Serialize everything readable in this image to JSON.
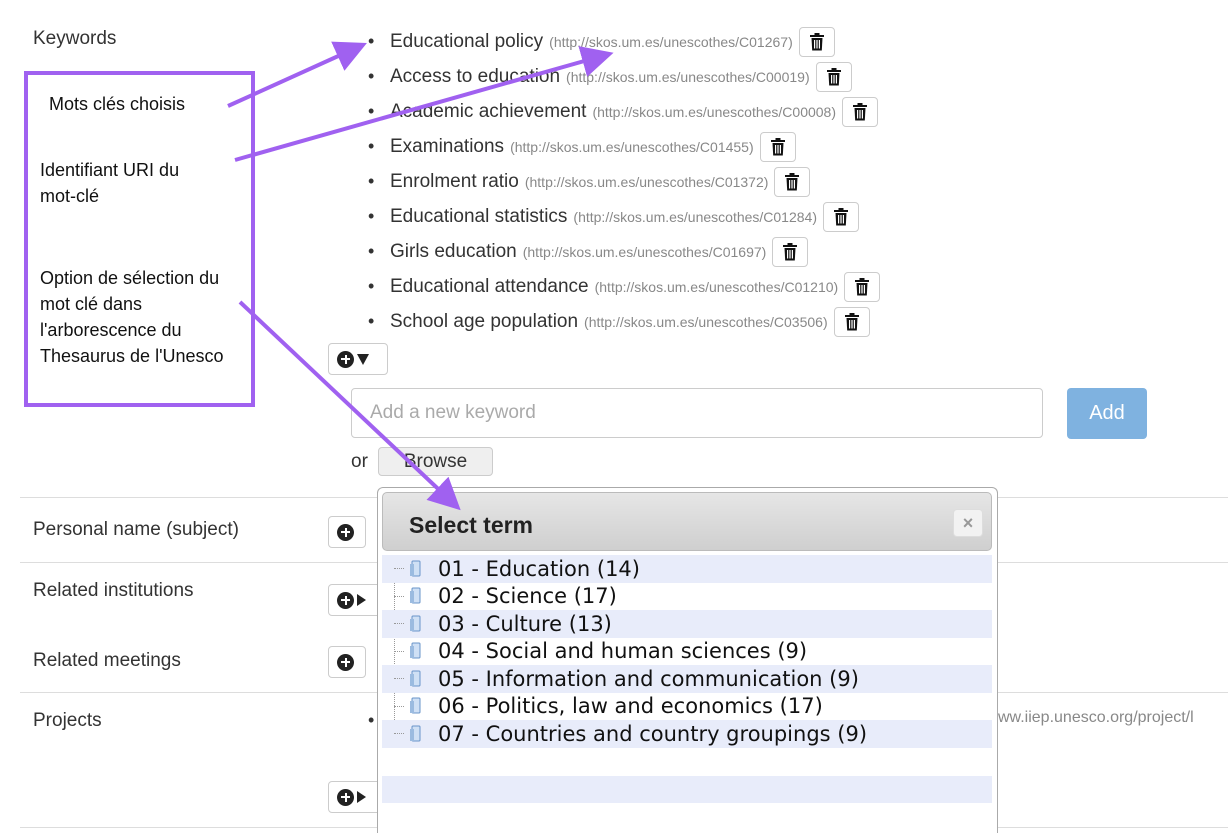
{
  "form": {
    "keywords_label": "Keywords",
    "personal_name_label": "Personal name (subject)",
    "related_institutions_label": "Related institutions",
    "related_meetings_label": "Related meetings",
    "projects_label": "Projects",
    "project_url_fragment": "ww.iiep.unesco.org/project/l",
    "keywords": [
      {
        "term": "Educational policy",
        "uri": "(http://skos.um.es/unescothes/C01267)"
      },
      {
        "term": "Access to education",
        "uri": "(http://skos.um.es/unescothes/C00019)"
      },
      {
        "term": "Academic achievement",
        "uri": "(http://skos.um.es/unescothes/C00008)"
      },
      {
        "term": "Examinations",
        "uri": "(http://skos.um.es/unescothes/C01455)"
      },
      {
        "term": "Enrolment ratio",
        "uri": "(http://skos.um.es/unescothes/C01372)"
      },
      {
        "term": "Educational statistics",
        "uri": "(http://skos.um.es/unescothes/C01284)"
      },
      {
        "term": "Girls education",
        "uri": "(http://skos.um.es/unescothes/C01697)"
      },
      {
        "term": "Educational attendance",
        "uri": "(http://skos.um.es/unescothes/C01210)"
      },
      {
        "term": "School age population",
        "uri": "(http://skos.um.es/unescothes/C03506)"
      }
    ],
    "new_keyword_placeholder": "Add a new keyword",
    "add_button": "Add",
    "or_text": "or",
    "browse_button": "Browse"
  },
  "dialog": {
    "title": "Select term",
    "close": "×",
    "tree": [
      "01 - Education (14)",
      "02 - Science (17)",
      "03 - Culture (13)",
      "04 - Social and human sciences (9)",
      "05 - Information and communication (9)",
      "06 - Politics, law and economics (17)",
      "07 - Countries and country groupings (9)"
    ]
  },
  "annotations": {
    "chosen_keywords": "Mots clés choisis",
    "uri_identifier": "Identifiant URI du mot-clé",
    "tree_option": "Option de sélection du mot clé dans l'arborescence du Thesaurus de l'Unesco"
  },
  "colors": {
    "annotation": "#a061f0",
    "add_button": "#7fb2e0",
    "tree_row_shade": "#e8ecfa"
  }
}
